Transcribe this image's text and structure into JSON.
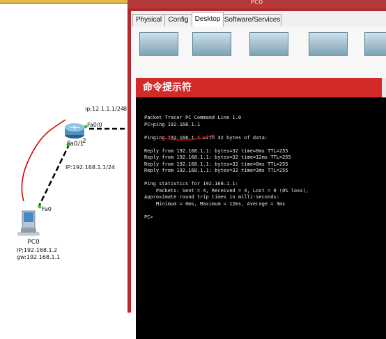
{
  "topology": {
    "router": {
      "name": "Router",
      "fa00": "Fa0/0",
      "fa01": "Fa0/1",
      "ip_top": "ip:12.1.1.1/24",
      "ip_lan": "IP:192.168.1.1/24",
      "suffix_char": "2",
      "edge_mark": "8"
    },
    "pc": {
      "name": "PC0",
      "port": "Fa0",
      "ip": "IP;192.168.1.2",
      "gw": "gw:192.168.1.1"
    }
  },
  "window": {
    "title": "PC0",
    "tabs": [
      {
        "label": "Physical"
      },
      {
        "label": "Config"
      },
      {
        "label": "Desktop"
      },
      {
        "label": "Software/Services"
      }
    ],
    "active_tab": "Desktop",
    "cmd_title": "命令提示符"
  },
  "console": {
    "lines": [
      "Packet Tracer PC Command Line 1.0",
      "PC>ping 192.168.1.1",
      "",
      "Pinging 192.168.1.1 with 32 bytes of data:",
      "",
      "Reply from 192.168.1.1: bytes=32 time=0ms TTL=255",
      "Reply from 192.168.1.1: bytes=32 time=12ms TTL=255",
      "Reply from 192.168.1.1: bytes=32 time=0ms TTL=255",
      "Reply from 192.168.1.1: bytes=32 time=3ms TTL=255",
      "",
      "Ping statistics for 192.168.1.1:",
      "    Packets: Sent = 4, Received = 4, Lost = 0 (0% loss),",
      "Approximate round trip times in milli-seconds:",
      "    Minimum = 0ms, Maximum = 12ms, Average = 3ms",
      "",
      "PC>"
    ]
  },
  "colors": {
    "link_dashed": "#000000",
    "port_up": "#2ecc2e",
    "annotation": "#d40000",
    "window_frame": "#b2292e",
    "console_bg": "#000000"
  }
}
